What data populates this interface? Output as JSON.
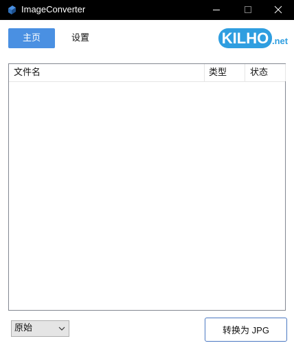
{
  "window": {
    "title": "ImageConverter",
    "controls": {
      "minimize": "minimize-icon",
      "maximize": "maximize-icon",
      "close": "close-icon"
    }
  },
  "tabs": [
    {
      "label": "主页",
      "active": true
    },
    {
      "label": "设置",
      "active": false
    }
  ],
  "logo": {
    "text": "KILHO",
    "suffix": ".net"
  },
  "file_list": {
    "columns": [
      "文件名",
      "类型",
      "状态"
    ],
    "rows": []
  },
  "footer": {
    "quality_select": {
      "value": "原始"
    },
    "convert_button": {
      "label": "转换为 JPG"
    }
  },
  "colors": {
    "titlebar": "#000000",
    "accent": "#4a90e2",
    "logo_blue": "#2f9ee0",
    "button_border": "#4a78c2"
  }
}
